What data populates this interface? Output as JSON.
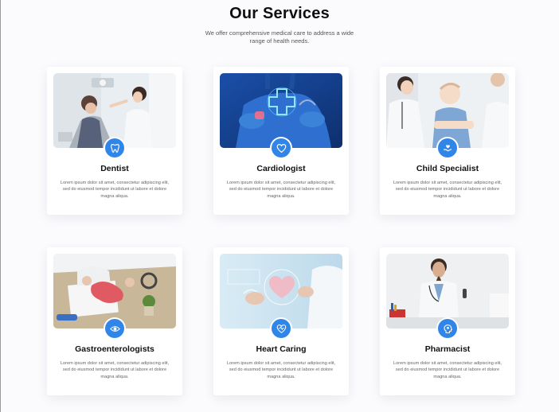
{
  "header": {
    "title": "Our Services",
    "subtitle": "We offer comprehensive medical care to address a wide range of health needs."
  },
  "accent_color": "#2f86e8",
  "services": [
    {
      "title": "Dentist",
      "icon": "tooth-icon",
      "image": "dentist-photo",
      "text": "Lorem ipsum dolor sit amet, consectetur adipiscing elit, sed do eiusmod tempor incididunt ut labore et dolore magna aliqua."
    },
    {
      "title": "Cardiologist",
      "icon": "heart-icon",
      "image": "cardiologist-photo",
      "text": "Lorem ipsum dolor sit amet, consectetur adipiscing elit, sed do eiusmod tempor incididunt ut labore et dolore magna aliqua."
    },
    {
      "title": "Child Specialist",
      "icon": "care-hand-icon",
      "image": "child-specialist-photo",
      "text": "Lorem ipsum dolor sit amet, consectetur adipiscing elit, sed do eiusmod tempor incididunt ut labore et dolore magna aliqua."
    },
    {
      "title": "Gastroenterologists",
      "icon": "eye-icon",
      "image": "gastroenterology-photo",
      "text": "Lorem ipsum dolor sit amet, consectetur adipiscing elit, sed do eiusmod tempor incididunt ut labore et dolore magna aliqua."
    },
    {
      "title": "Heart Caring",
      "icon": "heart-pulse-icon",
      "image": "heart-caring-photo",
      "text": "Lorem ipsum dolor sit amet, consectetur adipiscing elit, sed do eiusmod tempor incididunt ut labore et dolore magna aliqua."
    },
    {
      "title": "Pharmacist",
      "icon": "head-brain-icon",
      "image": "pharmacist-photo",
      "text": "Lorem ipsum dolor sit amet, consectetur adipiscing elit, sed do eiusmod tempor incididunt ut labore et dolore magna aliqua."
    }
  ]
}
